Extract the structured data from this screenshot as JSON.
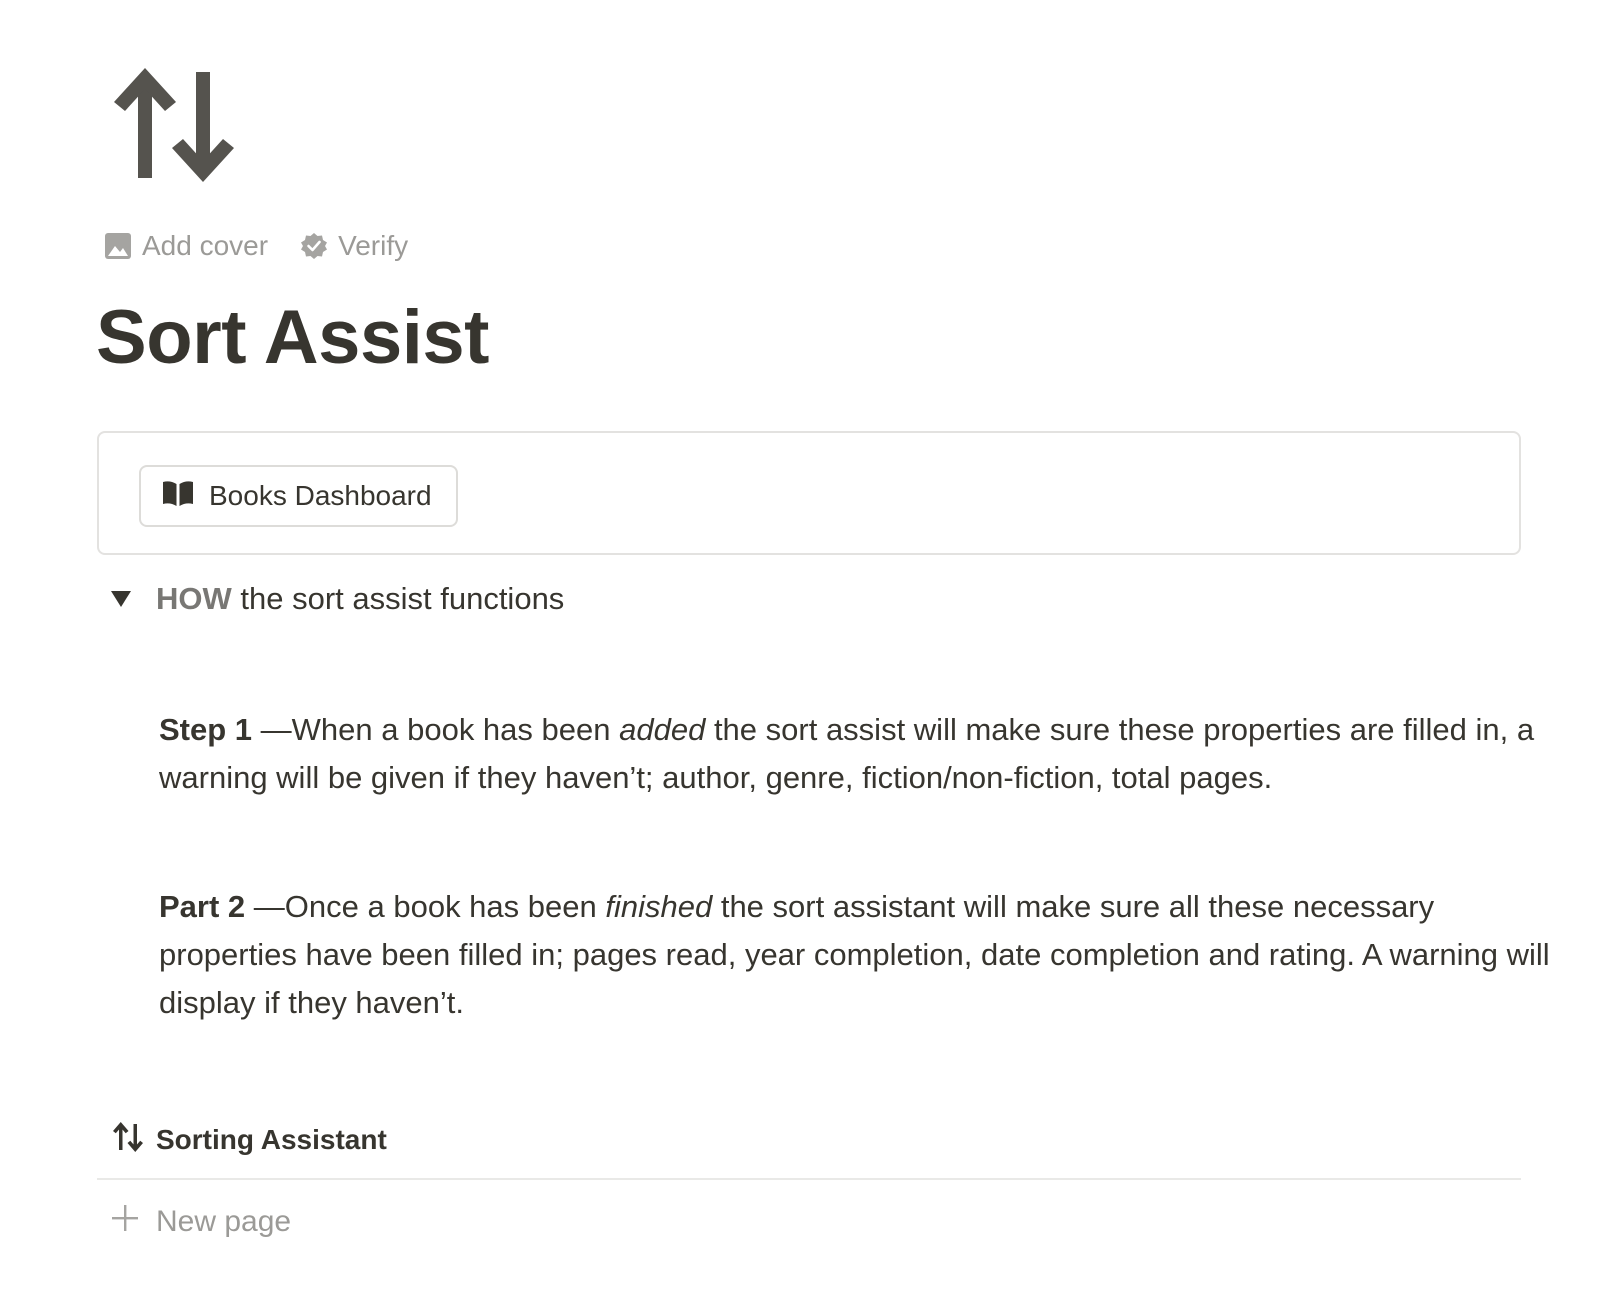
{
  "page": {
    "icon": "up-down-arrows-icon",
    "actions": {
      "add_cover": "Add cover",
      "verify": "Verify"
    },
    "title": "Sort Assist"
  },
  "callout": {
    "link_label": "Books Dashboard",
    "link_icon": "open-book-icon"
  },
  "toggle": {
    "expanded": true,
    "heading_strong": "HOW",
    "heading_rest": " the sort assist functions",
    "paragraphs": [
      {
        "lead": "Step 1",
        "text_a": " —When a book has been ",
        "emphasis": "added",
        "text_b": " the sort assist will make sure these properties are filled in, a warning will be given if they haven’t; author, genre, fiction/non-fiction, total pages."
      },
      {
        "lead": "Part 2",
        "text_a": " —Once a book has been ",
        "emphasis": "finished",
        "text_b": " the sort assistant will make sure all these necessary properties have been filled in; pages read, year completion, date completion and rating. A warning will display if they haven’t."
      }
    ]
  },
  "database": {
    "title": "Sorting Assistant",
    "icon": "up-down-arrows-icon",
    "new_page_label": "New page"
  },
  "colors": {
    "text": "#37352f",
    "muted": "#9b9a97",
    "icon": "#55534e",
    "border": "#e3e2e0"
  }
}
